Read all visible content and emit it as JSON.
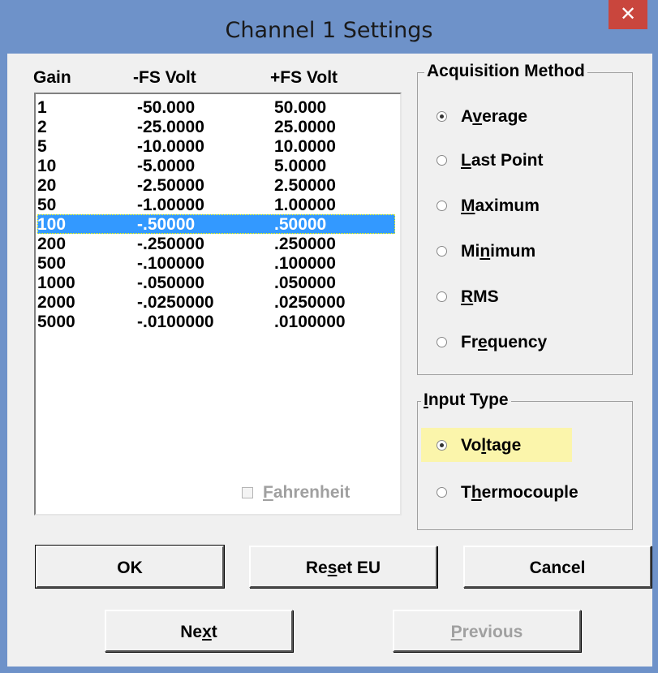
{
  "window": {
    "title": "Channel 1 Settings",
    "close_glyph": "✕"
  },
  "gain_list": {
    "headers": {
      "gain": "Gain",
      "neg": "-FS Volt",
      "pos": "+FS Volt"
    },
    "rows": [
      {
        "gain": "1",
        "neg": "-50.000",
        "pos": "50.000"
      },
      {
        "gain": "2",
        "neg": "-25.0000",
        "pos": "25.0000"
      },
      {
        "gain": "5",
        "neg": "-10.0000",
        "pos": "10.0000"
      },
      {
        "gain": "10",
        "neg": "-5.0000",
        "pos": "5.0000"
      },
      {
        "gain": "20",
        "neg": "-2.50000",
        "pos": "2.50000"
      },
      {
        "gain": "50",
        "neg": "-1.00000",
        "pos": "1.00000"
      },
      {
        "gain": "100",
        "neg": "-.50000",
        "pos": ".50000"
      },
      {
        "gain": "200",
        "neg": "-.250000",
        "pos": ".250000"
      },
      {
        "gain": "500",
        "neg": "-.100000",
        "pos": ".100000"
      },
      {
        "gain": "1000",
        "neg": "-.050000",
        "pos": ".050000"
      },
      {
        "gain": "2000",
        "neg": "-.0250000",
        "pos": ".0250000"
      },
      {
        "gain": "5000",
        "neg": "-.0100000",
        "pos": ".0100000"
      }
    ],
    "selected_index": 6
  },
  "acquisition": {
    "title": "Acquisition Method",
    "options": [
      {
        "pre": "A",
        "key": "v",
        "post": "erage",
        "checked": true
      },
      {
        "pre": "",
        "key": "L",
        "post": "ast Point",
        "checked": false
      },
      {
        "pre": "",
        "key": "M",
        "post": "aximum",
        "checked": false
      },
      {
        "pre": "Mi",
        "key": "n",
        "post": "imum",
        "checked": false
      },
      {
        "pre": "",
        "key": "R",
        "post": "MS",
        "checked": false
      },
      {
        "pre": "Fr",
        "key": "e",
        "post": "quency",
        "checked": false
      }
    ]
  },
  "input_type": {
    "title_key": "I",
    "title_rest": "nput Type",
    "voltage": {
      "pre": "Vo",
      "key": "l",
      "post": "tage",
      "checked": true
    },
    "thermocouple": {
      "pre": "T",
      "key": "h",
      "post": "ermocouple",
      "checked": false
    }
  },
  "fahrenheit": {
    "key": "F",
    "rest": "ahrenheit",
    "checked": false
  },
  "buttons": {
    "ok": "OK",
    "reset": {
      "pre": "Re",
      "key": "s",
      "post": "et EU"
    },
    "cancel": "Cancel",
    "next": {
      "pre": "Ne",
      "key": "x",
      "post": "t"
    },
    "previous": {
      "pre": "",
      "key": "P",
      "post": "revious"
    }
  },
  "colors": {
    "selection": "#3399ff",
    "highlight": "#fbf5ab",
    "title_bg": "#6e92c9",
    "close": "#c9463d"
  }
}
